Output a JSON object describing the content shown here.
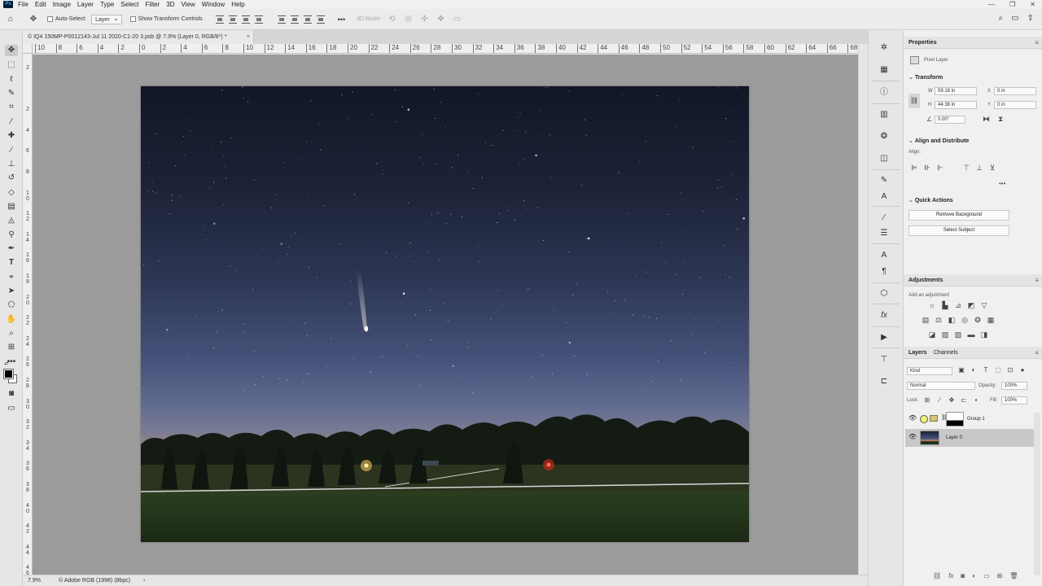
{
  "menubar": {
    "logo": "Ps",
    "items": [
      "File",
      "Edit",
      "Image",
      "Layer",
      "Type",
      "Select",
      "Filter",
      "3D",
      "View",
      "Window",
      "Help"
    ],
    "controls": [
      "—",
      "❐",
      "✕"
    ]
  },
  "options": {
    "auto_select_label": "Auto-Select:",
    "auto_select_value": "Layer",
    "transform_label": "Show Transform Controls",
    "more": "•••",
    "mode_3d": "3D Mode:"
  },
  "document": {
    "tab_title": "© IQ4 150MP-P0012143-Jul 11 2020-C1-20 3.psb @ 7.9% (Layer 0, RGB/8*) *",
    "close": "×"
  },
  "ruler": {
    "top": [
      "10",
      "8",
      "6",
      "4",
      "2",
      "0",
      "2",
      "4",
      "6",
      "8",
      "10",
      "12",
      "14",
      "16",
      "18",
      "20",
      "22",
      "24",
      "26",
      "28",
      "30",
      "32",
      "34",
      "36",
      "38",
      "40",
      "42",
      "44",
      "46",
      "48",
      "50",
      "52",
      "54",
      "56",
      "58",
      "60",
      "62",
      "64",
      "66",
      "68"
    ],
    "left": [
      "2",
      "",
      "2",
      "4",
      "6",
      "8",
      "1\n0",
      "1\n2",
      "1\n4",
      "1\n6",
      "1\n8",
      "2\n0",
      "2\n2",
      "2\n4",
      "2\n6",
      "2\n8",
      "3\n0",
      "3\n2",
      "3\n4",
      "3\n6",
      "3\n8",
      "4\n0",
      "4\n2",
      "4\n4",
      "4\n6"
    ]
  },
  "status": {
    "zoom": "7.9%",
    "profile": "© Adobe RGB (1998) (8bpc)",
    "arrow": "›"
  },
  "properties": {
    "tab": "Properties",
    "layer_type": "Pixel Layer",
    "transform_title": "Transform",
    "w_label": "W",
    "w_value": "59.18 in",
    "h_label": "H",
    "h_value": "44.38 in",
    "x_label": "X",
    "x_value": "0 in",
    "y_label": "Y",
    "y_value": "0 in",
    "angle_value": "0.00°",
    "align_title": "Align and Distribute",
    "align_label": "Align:",
    "more": "•••",
    "quick_actions_title": "Quick Actions",
    "remove_bg": "Remove Background",
    "select_subject": "Select Subject"
  },
  "adjustments": {
    "tab": "Adjustments",
    "add_label": "Add an adjustment"
  },
  "layers": {
    "tab_layers": "Layers",
    "tab_channels": "Channels",
    "kind": "Kind",
    "blend_mode": "Normal",
    "opacity_label": "Opacity:",
    "opacity_value": "100%",
    "lock_label": "Lock:",
    "fill_label": "Fill:",
    "fill_value": "100%",
    "items": [
      {
        "name": "Group 1"
      },
      {
        "name": "Layer 0"
      }
    ]
  }
}
